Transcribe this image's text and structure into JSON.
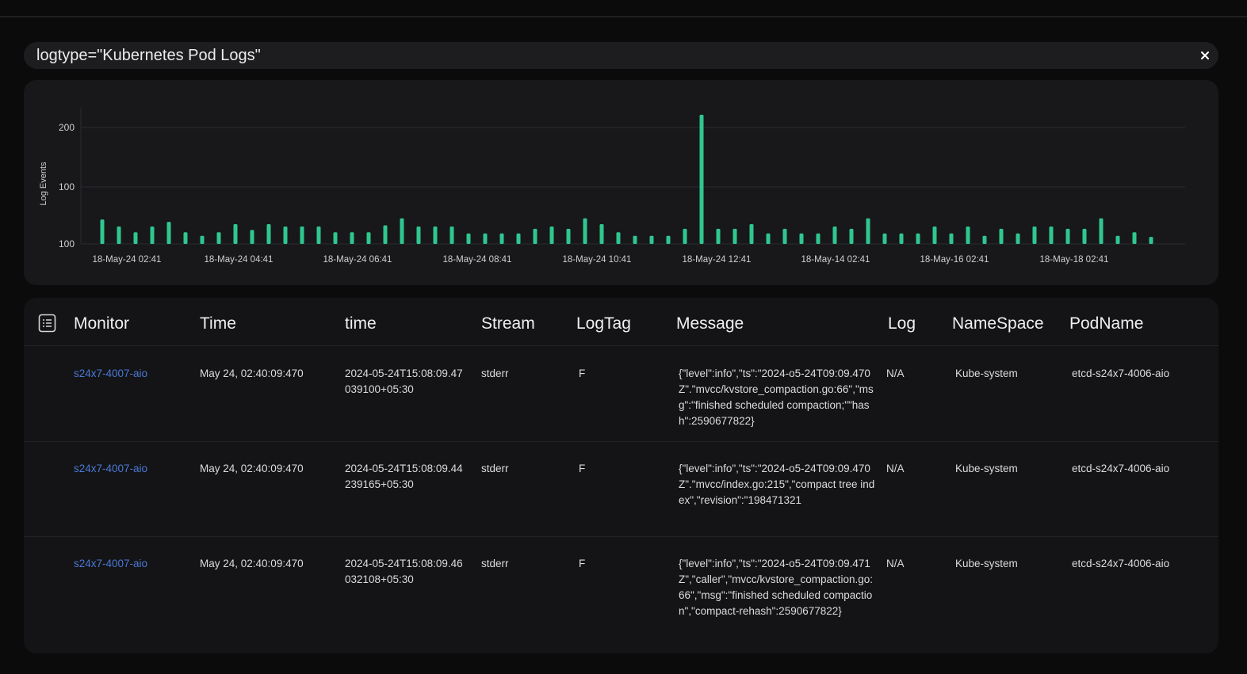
{
  "search": {
    "query": "logtype=\"Kubernetes Pod Logs\""
  },
  "chart_data": {
    "type": "bar",
    "ylabel": "Log Events",
    "y_tick_labels": [
      "100",
      "100",
      "200"
    ],
    "x_tick_labels": [
      "18-May-24 02:41",
      "18-May-24 04:41",
      "18-May-24 06:41",
      "18-May-24 08:41",
      "18-May-24 10:41",
      "18-May-24 12:41",
      "18-May-14 02:41",
      "18-May-16 02:41",
      "18-May-18 02:41"
    ],
    "ylim": [
      0,
      200
    ],
    "values": [
      42,
      30,
      20,
      30,
      38,
      20,
      14,
      20,
      34,
      24,
      34,
      30,
      30,
      30,
      20,
      20,
      20,
      32,
      44,
      30,
      30,
      30,
      18,
      18,
      18,
      18,
      26,
      30,
      26,
      44,
      34,
      20,
      14,
      14,
      14,
      26,
      222,
      26,
      26,
      34,
      18,
      26,
      18,
      18,
      30,
      26,
      44,
      18,
      18,
      18,
      30,
      18,
      30,
      14,
      26,
      18,
      30,
      30,
      26,
      26,
      44,
      14,
      20,
      12
    ],
    "bar_color": "#2fc78f"
  },
  "table": {
    "columns": [
      "Monitor",
      "Time",
      "time",
      "Stream",
      "LogTag",
      "Message",
      "Log",
      "NameSpace",
      "PodName"
    ],
    "rows": [
      {
        "monitor": "s24x7-4007-aio",
        "time_display": "May 24, 02:40:09:470",
        "time_raw": "2024-05-24T15:08:09.47039100+05:30",
        "stream": "stderr",
        "logtag": "F",
        "message": "{\"level\":info\",\"ts\":\"2024-o5-24T09:09.470Z\".\"mvcc/kvstore_compaction.go:66\",\"msg\":\"finished scheduled compaction;\"\"hash\":2590677822}",
        "log": "N/A",
        "namespace": "Kube-system",
        "podname": "etcd-s24x7-4006-aio"
      },
      {
        "monitor": "s24x7-4007-aio",
        "time_display": "May 24, 02:40:09:470",
        "time_raw": "2024-05-24T15:08:09.44239165+05:30",
        "stream": "stderr",
        "logtag": "F",
        "message": "{\"level\":info\",\"ts\":\"2024-o5-24T09:09.470Z\".\"mvcc/index.go:215\",\"compact tree index\",\"revision\":\"198471321",
        "log": "N/A",
        "namespace": "Kube-system",
        "podname": "etcd-s24x7-4006-aio"
      },
      {
        "monitor": "s24x7-4007-aio",
        "time_display": "May 24, 02:40:09:470",
        "time_raw": "2024-05-24T15:08:09.46032108+05:30",
        "stream": "stderr",
        "logtag": "F",
        "message": "{\"level\":info\",\"ts\":\"2024-o5-24T09:09.471Z\",\"caller\",\"mvcc/kvstore_compaction.go:66\",\"msg\":\"finished scheduled compaction\",\"compact-rehash\":2590677822}",
        "log": "N/A",
        "namespace": "Kube-system",
        "podname": "etcd-s24x7-4006-aio"
      }
    ]
  }
}
